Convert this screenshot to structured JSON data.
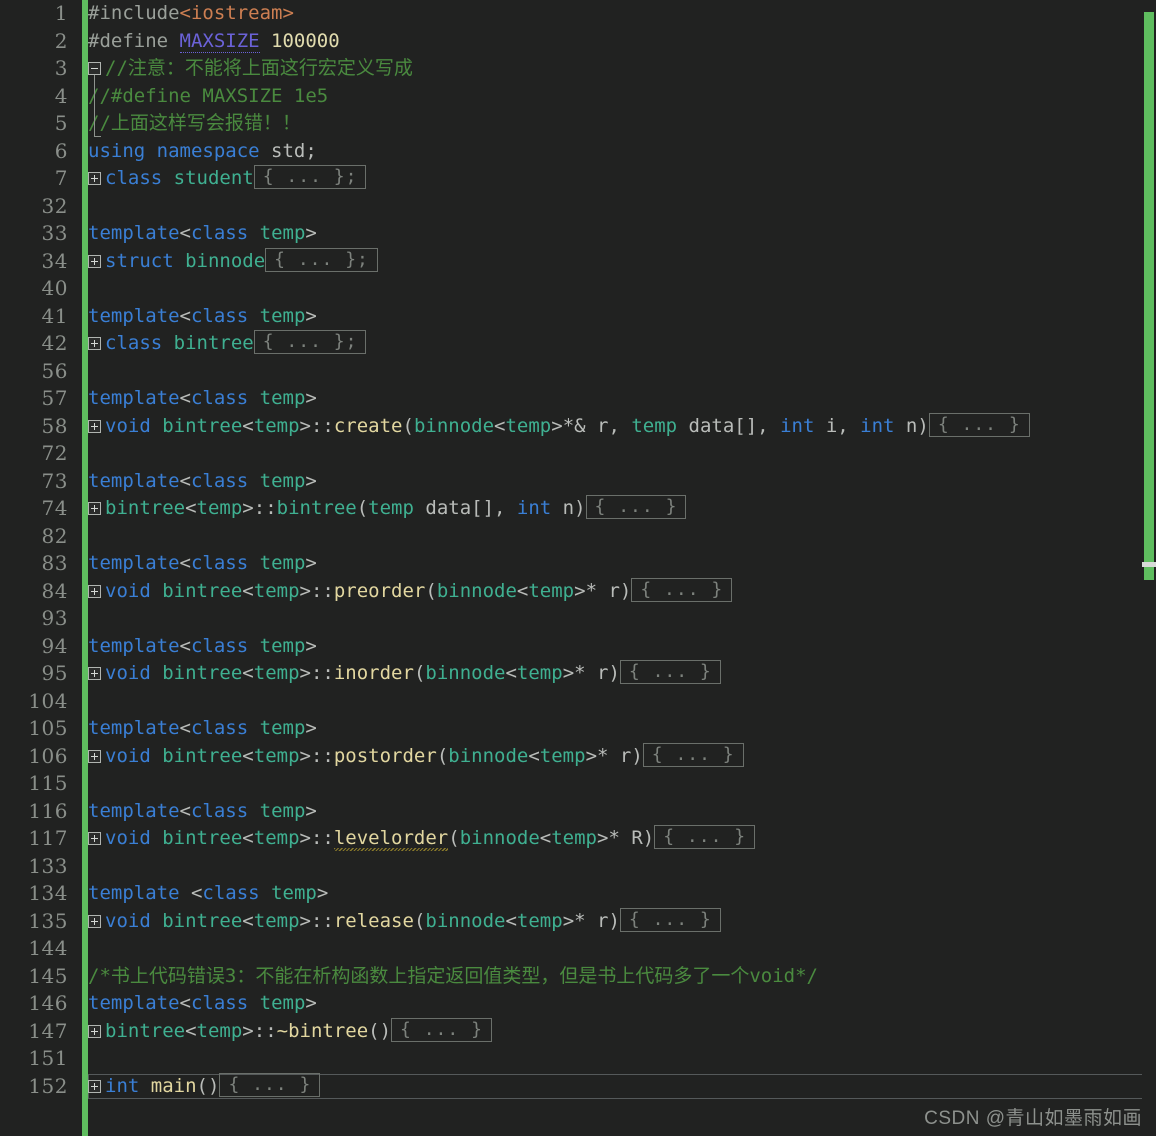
{
  "app": {
    "kind": "code-editor",
    "theme": "dark",
    "background": "#212221",
    "accent_green": "#5fbd5f",
    "watermark": "CSDN @青山如墨雨如画"
  },
  "scrollbar": {
    "name": "vertical-scrollbar",
    "thumb_color": "#5fbd5f",
    "marker_color": "#d8dad8"
  },
  "fold_placeholder": "{ ... }",
  "fold_placeholder_semi": "{ ... };",
  "lines": [
    {
      "no": "1",
      "marker": "none",
      "segments": [
        {
          "t": "#include",
          "c": "pp"
        },
        {
          "t": "<iostream>",
          "c": "hdr"
        }
      ]
    },
    {
      "no": "2",
      "marker": "none",
      "segments": [
        {
          "t": "#define ",
          "c": "pp"
        },
        {
          "t": "MAXSIZE",
          "c": "macro"
        },
        {
          "t": " ",
          "c": "plain"
        },
        {
          "t": "100000",
          "c": "num"
        }
      ]
    },
    {
      "no": "3",
      "marker": "minus",
      "segments": [
        {
          "t": "//注意：不能将上面这行宏定义写成",
          "c": "cmt"
        }
      ]
    },
    {
      "no": "4",
      "marker": "bar",
      "segments": [
        {
          "t": "//#define MAXSIZE 1e5",
          "c": "cmt"
        }
      ]
    },
    {
      "no": "5",
      "marker": "bar",
      "segments": [
        {
          "t": "//上面这样写会报错！！",
          "c": "cmt"
        }
      ]
    },
    {
      "no": "6",
      "marker": "none",
      "segments": [
        {
          "t": "using namespace",
          "c": "kw"
        },
        {
          "t": " std;",
          "c": "plain"
        }
      ]
    },
    {
      "no": "7",
      "marker": "plus",
      "segments": [
        {
          "t": "class",
          "c": "kw"
        },
        {
          "t": " ",
          "c": "plain"
        },
        {
          "t": "student",
          "c": "type"
        }
      ],
      "fold": "{ ... };"
    },
    {
      "no": "32",
      "marker": "none",
      "segments": []
    },
    {
      "no": "33",
      "marker": "none",
      "segments": [
        {
          "t": "template",
          "c": "kw"
        },
        {
          "t": "<",
          "c": "op"
        },
        {
          "t": "class",
          "c": "kw"
        },
        {
          "t": " ",
          "c": "plain"
        },
        {
          "t": "temp",
          "c": "type"
        },
        {
          "t": ">",
          "c": "op"
        }
      ]
    },
    {
      "no": "34",
      "marker": "plus",
      "segments": [
        {
          "t": "struct",
          "c": "kw"
        },
        {
          "t": " ",
          "c": "plain"
        },
        {
          "t": "binnode",
          "c": "type"
        }
      ],
      "fold": "{ ... };"
    },
    {
      "no": "40",
      "marker": "none",
      "segments": []
    },
    {
      "no": "41",
      "marker": "none",
      "segments": [
        {
          "t": "template",
          "c": "kw"
        },
        {
          "t": "<",
          "c": "op"
        },
        {
          "t": "class",
          "c": "kw"
        },
        {
          "t": " ",
          "c": "plain"
        },
        {
          "t": "temp",
          "c": "type"
        },
        {
          "t": ">",
          "c": "op"
        }
      ]
    },
    {
      "no": "42",
      "marker": "plus",
      "segments": [
        {
          "t": "class",
          "c": "kw"
        },
        {
          "t": " ",
          "c": "plain"
        },
        {
          "t": "bintree",
          "c": "type"
        }
      ],
      "fold": "{ ... };"
    },
    {
      "no": "56",
      "marker": "none",
      "segments": []
    },
    {
      "no": "57",
      "marker": "none",
      "segments": [
        {
          "t": "template",
          "c": "kw"
        },
        {
          "t": "<",
          "c": "op"
        },
        {
          "t": "class",
          "c": "kw"
        },
        {
          "t": " ",
          "c": "plain"
        },
        {
          "t": "temp",
          "c": "type"
        },
        {
          "t": ">",
          "c": "op"
        }
      ]
    },
    {
      "no": "58",
      "marker": "plus",
      "segments": [
        {
          "t": "void",
          "c": "kw"
        },
        {
          "t": " ",
          "c": "plain"
        },
        {
          "t": "bintree",
          "c": "type"
        },
        {
          "t": "<",
          "c": "op"
        },
        {
          "t": "temp",
          "c": "type"
        },
        {
          "t": ">",
          "c": "op"
        },
        {
          "t": "::",
          "c": "plain"
        },
        {
          "t": "create",
          "c": "fn"
        },
        {
          "t": "(",
          "c": "op"
        },
        {
          "t": "binnode",
          "c": "type"
        },
        {
          "t": "<",
          "c": "op"
        },
        {
          "t": "temp",
          "c": "type"
        },
        {
          "t": ">",
          "c": "op"
        },
        {
          "t": "*& r, ",
          "c": "plain"
        },
        {
          "t": "temp",
          "c": "type"
        },
        {
          "t": " data[], ",
          "c": "plain"
        },
        {
          "t": "int",
          "c": "kw"
        },
        {
          "t": " i, ",
          "c": "plain"
        },
        {
          "t": "int",
          "c": "kw"
        },
        {
          "t": " n)",
          "c": "plain"
        }
      ],
      "fold": "{ ... }"
    },
    {
      "no": "72",
      "marker": "none",
      "segments": []
    },
    {
      "no": "73",
      "marker": "none",
      "segments": [
        {
          "t": "template",
          "c": "kw"
        },
        {
          "t": "<",
          "c": "op"
        },
        {
          "t": "class",
          "c": "kw"
        },
        {
          "t": " ",
          "c": "plain"
        },
        {
          "t": "temp",
          "c": "type"
        },
        {
          "t": ">",
          "c": "op"
        }
      ]
    },
    {
      "no": "74",
      "marker": "plus",
      "segments": [
        {
          "t": "bintree",
          "c": "type"
        },
        {
          "t": "<",
          "c": "op"
        },
        {
          "t": "temp",
          "c": "type"
        },
        {
          "t": ">",
          "c": "op"
        },
        {
          "t": "::",
          "c": "plain"
        },
        {
          "t": "bintree",
          "c": "type"
        },
        {
          "t": "(",
          "c": "op"
        },
        {
          "t": "temp",
          "c": "type"
        },
        {
          "t": " data[], ",
          "c": "plain"
        },
        {
          "t": "int",
          "c": "kw"
        },
        {
          "t": " n)",
          "c": "plain"
        }
      ],
      "fold": "{ ... }"
    },
    {
      "no": "82",
      "marker": "none",
      "segments": []
    },
    {
      "no": "83",
      "marker": "none",
      "segments": [
        {
          "t": "template",
          "c": "kw"
        },
        {
          "t": "<",
          "c": "op"
        },
        {
          "t": "class",
          "c": "kw"
        },
        {
          "t": " ",
          "c": "plain"
        },
        {
          "t": "temp",
          "c": "type"
        },
        {
          "t": ">",
          "c": "op"
        }
      ]
    },
    {
      "no": "84",
      "marker": "plus",
      "segments": [
        {
          "t": "void",
          "c": "kw"
        },
        {
          "t": " ",
          "c": "plain"
        },
        {
          "t": "bintree",
          "c": "type"
        },
        {
          "t": "<",
          "c": "op"
        },
        {
          "t": "temp",
          "c": "type"
        },
        {
          "t": ">",
          "c": "op"
        },
        {
          "t": "::",
          "c": "plain"
        },
        {
          "t": "preorder",
          "c": "fn"
        },
        {
          "t": "(",
          "c": "op"
        },
        {
          "t": "binnode",
          "c": "type"
        },
        {
          "t": "<",
          "c": "op"
        },
        {
          "t": "temp",
          "c": "type"
        },
        {
          "t": ">",
          "c": "op"
        },
        {
          "t": "* r)",
          "c": "plain"
        }
      ],
      "fold": "{ ... }"
    },
    {
      "no": "93",
      "marker": "none",
      "segments": []
    },
    {
      "no": "94",
      "marker": "none",
      "segments": [
        {
          "t": "template",
          "c": "kw"
        },
        {
          "t": "<",
          "c": "op"
        },
        {
          "t": "class",
          "c": "kw"
        },
        {
          "t": " ",
          "c": "plain"
        },
        {
          "t": "temp",
          "c": "type"
        },
        {
          "t": ">",
          "c": "op"
        }
      ]
    },
    {
      "no": "95",
      "marker": "plus",
      "segments": [
        {
          "t": "void",
          "c": "kw"
        },
        {
          "t": " ",
          "c": "plain"
        },
        {
          "t": "bintree",
          "c": "type"
        },
        {
          "t": "<",
          "c": "op"
        },
        {
          "t": "temp",
          "c": "type"
        },
        {
          "t": ">",
          "c": "op"
        },
        {
          "t": "::",
          "c": "plain"
        },
        {
          "t": "inorder",
          "c": "fn"
        },
        {
          "t": "(",
          "c": "op"
        },
        {
          "t": "binnode",
          "c": "type"
        },
        {
          "t": "<",
          "c": "op"
        },
        {
          "t": "temp",
          "c": "type"
        },
        {
          "t": ">",
          "c": "op"
        },
        {
          "t": "* r)",
          "c": "plain"
        }
      ],
      "fold": "{ ... }"
    },
    {
      "no": "104",
      "marker": "none",
      "segments": []
    },
    {
      "no": "105",
      "marker": "none",
      "segments": [
        {
          "t": "template",
          "c": "kw"
        },
        {
          "t": "<",
          "c": "op"
        },
        {
          "t": "class",
          "c": "kw"
        },
        {
          "t": " ",
          "c": "plain"
        },
        {
          "t": "temp",
          "c": "type"
        },
        {
          "t": ">",
          "c": "op"
        }
      ]
    },
    {
      "no": "106",
      "marker": "plus",
      "segments": [
        {
          "t": "void",
          "c": "kw"
        },
        {
          "t": " ",
          "c": "plain"
        },
        {
          "t": "bintree",
          "c": "type"
        },
        {
          "t": "<",
          "c": "op"
        },
        {
          "t": "temp",
          "c": "type"
        },
        {
          "t": ">",
          "c": "op"
        },
        {
          "t": "::",
          "c": "plain"
        },
        {
          "t": "postorder",
          "c": "fn"
        },
        {
          "t": "(",
          "c": "op"
        },
        {
          "t": "binnode",
          "c": "type"
        },
        {
          "t": "<",
          "c": "op"
        },
        {
          "t": "temp",
          "c": "type"
        },
        {
          "t": ">",
          "c": "op"
        },
        {
          "t": "* r)",
          "c": "plain"
        }
      ],
      "fold": "{ ... }"
    },
    {
      "no": "115",
      "marker": "none",
      "segments": []
    },
    {
      "no": "116",
      "marker": "none",
      "segments": [
        {
          "t": "template",
          "c": "kw"
        },
        {
          "t": "<",
          "c": "op"
        },
        {
          "t": "class",
          "c": "kw"
        },
        {
          "t": " ",
          "c": "plain"
        },
        {
          "t": "temp",
          "c": "type"
        },
        {
          "t": ">",
          "c": "op"
        }
      ]
    },
    {
      "no": "117",
      "marker": "plus",
      "segments": [
        {
          "t": "void",
          "c": "kw"
        },
        {
          "t": " ",
          "c": "plain"
        },
        {
          "t": "bintree",
          "c": "type"
        },
        {
          "t": "<",
          "c": "op"
        },
        {
          "t": "temp",
          "c": "type"
        },
        {
          "t": ">",
          "c": "op"
        },
        {
          "t": "::",
          "c": "plain"
        },
        {
          "t": "levelorder",
          "c": "fn spell"
        },
        {
          "t": "(",
          "c": "op"
        },
        {
          "t": "binnode",
          "c": "type"
        },
        {
          "t": "<",
          "c": "op"
        },
        {
          "t": "temp",
          "c": "type"
        },
        {
          "t": ">",
          "c": "op"
        },
        {
          "t": "* R)",
          "c": "plain"
        }
      ],
      "fold": "{ ... }"
    },
    {
      "no": "133",
      "marker": "none",
      "segments": []
    },
    {
      "no": "134",
      "marker": "none",
      "segments": [
        {
          "t": "template",
          "c": "kw"
        },
        {
          "t": " <",
          "c": "op"
        },
        {
          "t": "class",
          "c": "kw"
        },
        {
          "t": " ",
          "c": "plain"
        },
        {
          "t": "temp",
          "c": "type"
        },
        {
          "t": ">",
          "c": "op"
        }
      ]
    },
    {
      "no": "135",
      "marker": "plus",
      "segments": [
        {
          "t": "void",
          "c": "kw"
        },
        {
          "t": " ",
          "c": "plain"
        },
        {
          "t": "bintree",
          "c": "type"
        },
        {
          "t": "<",
          "c": "op"
        },
        {
          "t": "temp",
          "c": "type"
        },
        {
          "t": ">",
          "c": "op"
        },
        {
          "t": "::",
          "c": "plain"
        },
        {
          "t": "release",
          "c": "fn"
        },
        {
          "t": "(",
          "c": "op"
        },
        {
          "t": "binnode",
          "c": "type"
        },
        {
          "t": "<",
          "c": "op"
        },
        {
          "t": "temp",
          "c": "type"
        },
        {
          "t": ">",
          "c": "op"
        },
        {
          "t": "* r)",
          "c": "plain"
        }
      ],
      "fold": "{ ... }"
    },
    {
      "no": "144",
      "marker": "none",
      "segments": []
    },
    {
      "no": "145",
      "marker": "none",
      "segments": [
        {
          "t": "/*书上代码错误3：不能在析构函数上指定返回值类型，但是书上代码多了一个void*/",
          "c": "cmt"
        }
      ]
    },
    {
      "no": "146",
      "marker": "none",
      "segments": [
        {
          "t": "template",
          "c": "kw"
        },
        {
          "t": "<",
          "c": "op"
        },
        {
          "t": "class",
          "c": "kw"
        },
        {
          "t": " ",
          "c": "plain"
        },
        {
          "t": "temp",
          "c": "type"
        },
        {
          "t": ">",
          "c": "op"
        }
      ]
    },
    {
      "no": "147",
      "marker": "plus",
      "segments": [
        {
          "t": "bintree",
          "c": "type"
        },
        {
          "t": "<",
          "c": "op"
        },
        {
          "t": "temp",
          "c": "type"
        },
        {
          "t": ">",
          "c": "op"
        },
        {
          "t": "::",
          "c": "plain"
        },
        {
          "t": "~bintree",
          "c": "fn"
        },
        {
          "t": "()",
          "c": "op"
        }
      ],
      "fold": "{ ... }"
    },
    {
      "no": "151",
      "marker": "none",
      "segments": []
    },
    {
      "no": "152",
      "marker": "plus",
      "current": true,
      "segments": [
        {
          "t": "int",
          "c": "kw"
        },
        {
          "t": " ",
          "c": "plain"
        },
        {
          "t": "main",
          "c": "fn"
        },
        {
          "t": "()",
          "c": "op"
        }
      ],
      "fold": "{ ... }"
    }
  ]
}
